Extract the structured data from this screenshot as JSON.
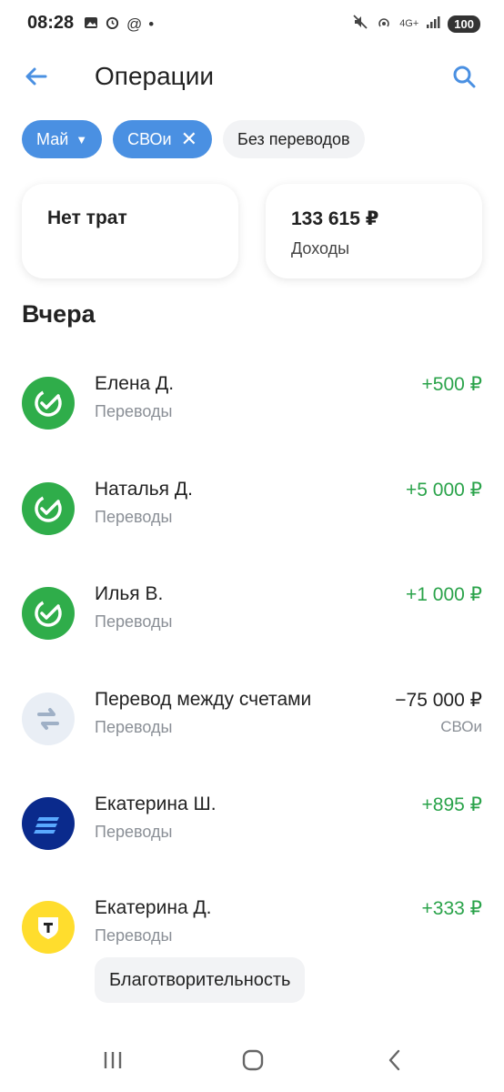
{
  "status_bar": {
    "time": "08:28",
    "at_symbol": "@",
    "dot": "•",
    "network": "4G+",
    "battery": "100"
  },
  "header": {
    "title": "Операции"
  },
  "filters": {
    "month": "Май",
    "account": "СВОи",
    "no_transfers": "Без переводов"
  },
  "summary": {
    "expenses_label": "Нет трат",
    "income_amount": "133 615 ₽",
    "income_label": "Доходы"
  },
  "section_title": "Вчера",
  "transactions": [
    {
      "name": "Елена Д.",
      "category": "Переводы",
      "amount": "+500 ₽",
      "note": "",
      "icon": "sber-check-icon"
    },
    {
      "name": "Наталья Д.",
      "category": "Переводы",
      "amount": "+5 000 ₽",
      "note": "",
      "icon": "sber-check-icon"
    },
    {
      "name": "Илья В.",
      "category": "Переводы",
      "amount": "+1 000 ₽",
      "note": "",
      "icon": "sber-check-icon"
    },
    {
      "name": "Перевод между счетами",
      "category": "Переводы",
      "amount": "−75 000 ₽",
      "note": "СВОи",
      "icon": "transfer-arrows-icon"
    },
    {
      "name": "Екатерина Ш.",
      "category": "Переводы",
      "amount": "+895 ₽",
      "note": "",
      "icon": "vtb-stripes-icon"
    },
    {
      "name": "Екатерина Д.",
      "category": "Переводы",
      "amount": "+333 ₽",
      "note": "",
      "icon": "tbank-shield-icon"
    }
  ],
  "tag_chip": "Благотворительность",
  "colors": {
    "accent": "#4a90e2",
    "positive": "#2aa34a",
    "sber_green": "#2fad4a",
    "vtb_blue": "#0a2a8c",
    "tbank_yellow": "#ffdd2d"
  }
}
